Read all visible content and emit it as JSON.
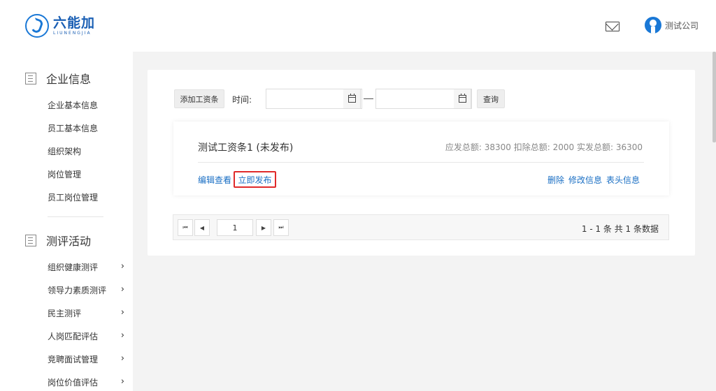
{
  "brand": {
    "name_cn": "六能加",
    "name_en": "LIUNENGJIA",
    "accent": "#1a78d6"
  },
  "header": {
    "mail_icon": "mail-icon",
    "user_name": "测试公司"
  },
  "sidebar": {
    "sections": [
      {
        "title": "企业信息",
        "icon": "building-icon",
        "items": [
          "企业基本信息",
          "员工基本信息",
          "组织架构",
          "岗位管理",
          "员工岗位管理"
        ]
      },
      {
        "title": "测评活动",
        "icon": "clipboard-icon",
        "items": [
          "组织健康测评",
          "领导力素质测评",
          "民主测评",
          "人岗匹配评估",
          "竞聘面试管理",
          "岗位价值评估"
        ]
      }
    ]
  },
  "toolbar": {
    "add_label": "添加工资条",
    "time_label": "时间:",
    "start_date": "",
    "end_date": "",
    "query_label": "查询"
  },
  "card": {
    "title": "测试工资条1 (未发布)",
    "stats": "应发总额: 38300 扣除总额: 2000 实发总额: 36300",
    "edit_view": "编辑查看",
    "publish": "立即发布",
    "delete": "删除",
    "modify": "修改信息",
    "header_info": "表头信息",
    "highlight_color": "#e02a2a"
  },
  "pager": {
    "first": "⏮",
    "prev": "◀",
    "page": "1",
    "next": "▶",
    "last": "⏭",
    "info": "1 - 1 条   共 1 条数据"
  }
}
